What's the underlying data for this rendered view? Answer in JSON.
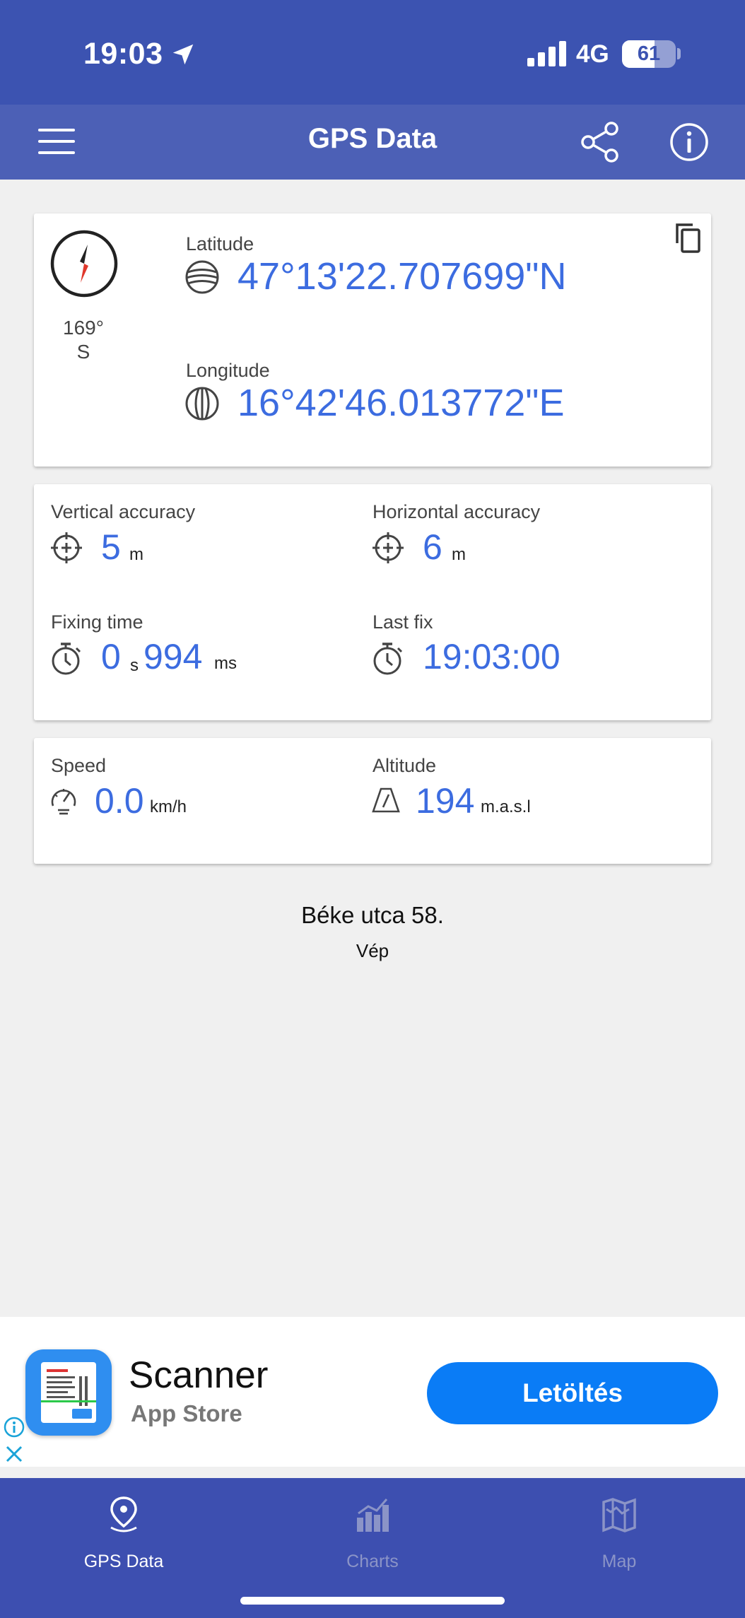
{
  "status_bar": {
    "time": "19:03",
    "network": "4G",
    "battery": "61"
  },
  "app_bar": {
    "title": "GPS Data"
  },
  "coordinates": {
    "heading_degrees": "169°",
    "heading_direction": "S",
    "latitude_label": "Latitude",
    "latitude_value": "47°13'22.707699\"N",
    "longitude_label": "Longitude",
    "longitude_value": "16°42'46.013772\"E"
  },
  "accuracy": {
    "vertical_label": "Vertical accuracy",
    "vertical_value": "5",
    "vertical_unit": "m",
    "horizontal_label": "Horizontal accuracy",
    "horizontal_value": "6",
    "horizontal_unit": "m",
    "fixing_label": "Fixing time",
    "fixing_seconds": "0",
    "fixing_seconds_unit": "s",
    "fixing_ms": "994",
    "fixing_ms_unit": "ms",
    "last_fix_label": "Last fix",
    "last_fix_value": "19:03:00"
  },
  "motion": {
    "speed_label": "Speed",
    "speed_value": "0.0",
    "speed_unit": "km/h",
    "altitude_label": "Altitude",
    "altitude_value": "194",
    "altitude_unit": "m.a.s.l"
  },
  "address": {
    "street": "Béke utca 58.",
    "city": "Vép"
  },
  "ad": {
    "app_name": "Scanner",
    "store": "App Store",
    "cta": "Letöltés"
  },
  "tabs": [
    {
      "label": "GPS Data",
      "active": true
    },
    {
      "label": "Charts",
      "active": false
    },
    {
      "label": "Map",
      "active": false
    }
  ],
  "colors": {
    "status_bar": "#3c53b1",
    "app_bar": "#4c60b6",
    "value_blue": "#3c6ce0",
    "tab_bar": "#3d4fb0",
    "cta_blue": "#0a7cf6",
    "compass_red": "#e0382c"
  },
  "icons": {
    "status_bar": [
      "location-arrow-icon",
      "signal-icon",
      "battery-icon"
    ],
    "app_bar": [
      "menu-icon",
      "share-icon",
      "info-icon"
    ],
    "cards": [
      "compass-icon",
      "copy-icon",
      "globe-latitude-icon",
      "globe-longitude-icon",
      "crosshair-icon",
      "stopwatch-icon",
      "speedometer-icon",
      "altitude-icon"
    ],
    "ad": [
      "ad-info-icon",
      "ad-close-icon"
    ],
    "tabs": [
      "map-pin-icon",
      "bar-chart-icon",
      "map-icon"
    ]
  }
}
